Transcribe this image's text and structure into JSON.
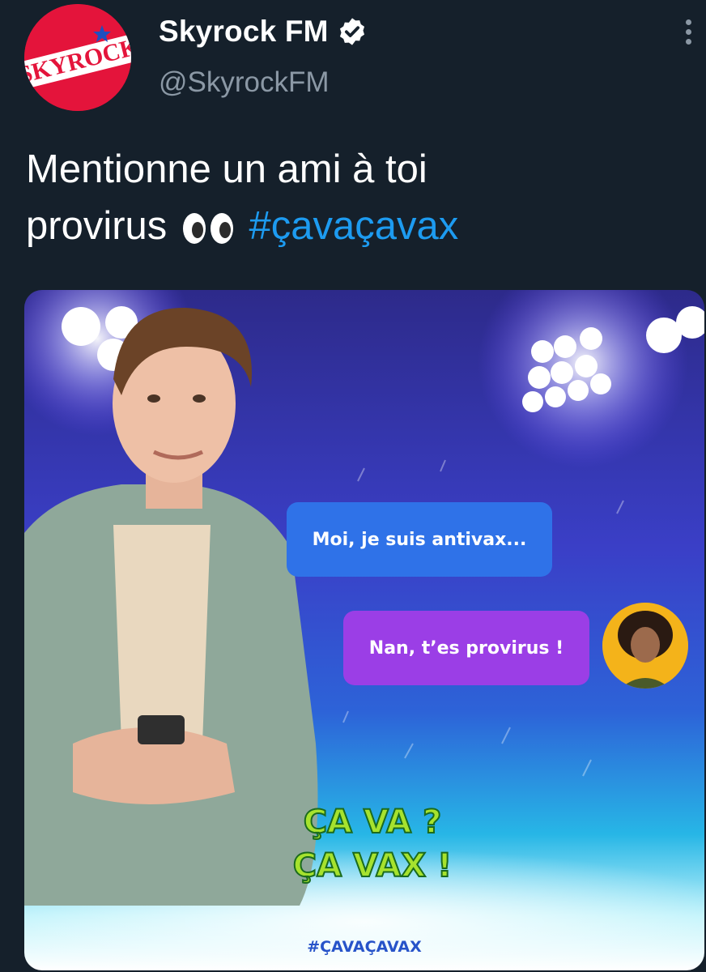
{
  "tweet": {
    "display_name": "Skyrock FM",
    "handle": "@SkyrockFM",
    "verified_icon": "verified-badge-icon",
    "more_icon": "more-options-icon",
    "text_line1": "Mentionne un ami à toi",
    "text_line2_word": "provirus",
    "text_emoji": "eyes-emoji-icon",
    "hashtag": "#çavaçavax",
    "hashtag_color": "#1d9bf0"
  },
  "avatar": {
    "logo_text": "SKYROCK",
    "brand_color": "#e4143b"
  },
  "media": {
    "bubble_1": "Moi, je suis antivax...",
    "bubble_2": "Nan, t’es provirus !",
    "logo_line1": "ÇA VA ?",
    "logo_line2": "ÇA VAX !",
    "footer_hashtag": "#ÇAVAÇAVAX",
    "bubble_1_color": "#2f72e8",
    "bubble_2_color": "#9b3ee6"
  }
}
